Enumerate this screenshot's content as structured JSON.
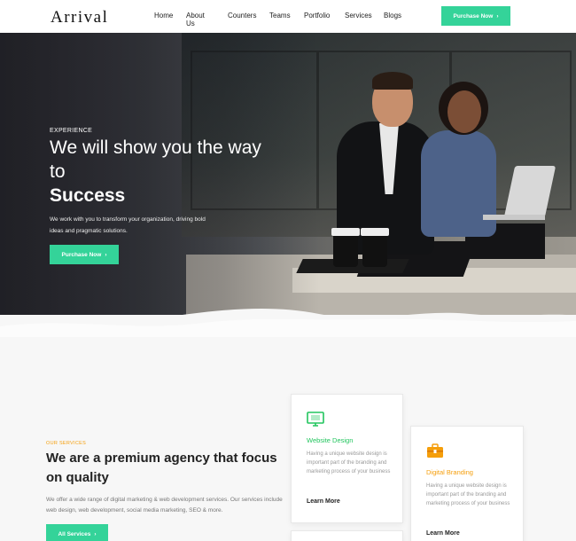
{
  "brand": {
    "logo": "Arrival"
  },
  "nav": {
    "items": [
      "Home",
      "About Us",
      "Counters",
      "Teams",
      "Portfolio",
      "Services",
      "Blogs"
    ]
  },
  "header": {
    "cta_label": "Purchase Now"
  },
  "hero": {
    "kicker": "EXPERIENCE",
    "title_line": "We will show you the way to",
    "title_bold": "Success",
    "description": "We work with you to transform your organization, driving bold ideas and pragmatic solutions.",
    "cta_label": "Purchase Now"
  },
  "services": {
    "kicker": "OUR SERVICES",
    "title": "We are a premium agency that focus on quality",
    "description": "We offer a wide range of digital marketing & web development services. Our services include web design, web development, social media marketing, SEO & more.",
    "cta_label": "All Services",
    "cards": [
      {
        "icon": "monitor-icon",
        "title": "Website Design",
        "description": "Having a unique website design is important part of the branding and marketing process of your business",
        "link": "Learn More",
        "color": "#22c55e"
      },
      {
        "icon": "briefcase-icon",
        "title": "Digital Branding",
        "description": "Having a unique website design is important part of the branding and marketing process of your business",
        "link": "Learn More",
        "color": "#f59e0b"
      }
    ]
  },
  "colors": {
    "accent": "#34d399",
    "orange": "#f59e0b",
    "green": "#22c55e"
  }
}
